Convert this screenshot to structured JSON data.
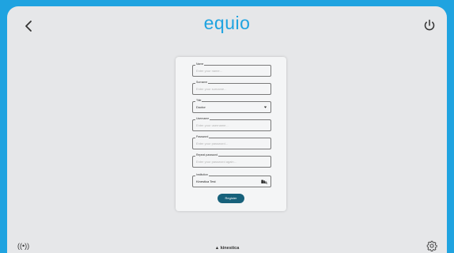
{
  "app": {
    "logo_text": "equio",
    "brand_color": "#1fa3e0",
    "bottom_brand": "kinestica"
  },
  "header": {
    "back_icon": "chevron-left-icon",
    "power_icon": "power-icon"
  },
  "form": {
    "fields": [
      {
        "label": "Name",
        "placeholder": "Enter your name..."
      },
      {
        "label": "Surname",
        "placeholder": "Enter your surname..."
      },
      {
        "label": "Title",
        "value": "Doctor"
      },
      {
        "label": "Username",
        "placeholder": "Enter your username..."
      },
      {
        "label": "Password",
        "placeholder": "Enter your password..."
      },
      {
        "label": "Repeat password",
        "placeholder": "Enter your password again..."
      },
      {
        "label": "Institution",
        "value": "Kinestica Test"
      }
    ],
    "register_label": "Register",
    "register_color": "#17617b"
  },
  "footer": {
    "wireless_icon": "wireless-signal-icon",
    "settings_icon": "gear-icon"
  }
}
